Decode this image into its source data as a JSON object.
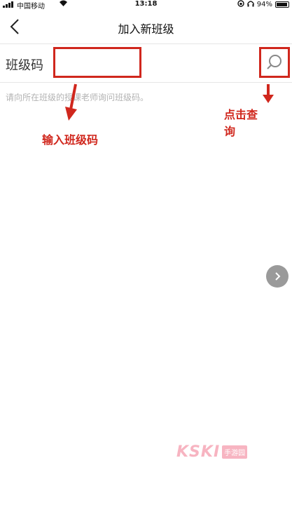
{
  "status_bar": {
    "carrier": "中国移动",
    "time": "13:18",
    "battery": "94%",
    "battery_level": 0.94
  },
  "nav": {
    "title": "加入新班级"
  },
  "form": {
    "label": "班级码",
    "input_value": "",
    "hint": "请向所在班级的授课老师询问班级码。"
  },
  "annotations": {
    "input": "输入班级码",
    "search": "点击查询"
  },
  "watermark": {
    "brand": "KSKI",
    "tag": "手游园"
  },
  "colors": {
    "annotation": "#d0271d",
    "hint": "#b3b3b3"
  },
  "icons": {
    "back": "back-chevron-icon",
    "search": "search-icon",
    "next": "chevron-right-icon"
  }
}
